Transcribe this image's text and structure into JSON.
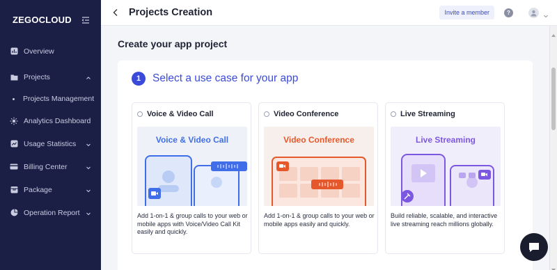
{
  "brand": {
    "logo": "ZEGOCLOUD"
  },
  "sidebar": {
    "items": [
      {
        "label": "Overview",
        "icon": "overview-icon"
      },
      {
        "label": "Projects",
        "icon": "projects-icon",
        "expanded": true
      },
      {
        "label": "Projects Management",
        "sub": true
      },
      {
        "label": "Analytics Dashboard",
        "icon": "analytics-icon"
      },
      {
        "label": "Usage Statistics",
        "icon": "usage-icon"
      },
      {
        "label": "Billing Center",
        "icon": "billing-icon"
      },
      {
        "label": "Package",
        "icon": "package-icon"
      },
      {
        "label": "Operation Report",
        "icon": "report-icon"
      }
    ]
  },
  "header": {
    "title": "Projects Creation",
    "invite_label": "Invite a member",
    "help_glyph": "?"
  },
  "main": {
    "heading": "Create your app project",
    "step": {
      "number": "1",
      "title": "Select a use case for your app"
    },
    "cards": [
      {
        "label": "Voice & Video Call",
        "art_title": "Voice & Video Call",
        "art_color": "#3f6ee8",
        "description": "Add 1-on-1 & group calls to your web or mobile apps with Voice/Video Call Kit easily and quickly."
      },
      {
        "label": "Video Conference",
        "art_title": "Video Conference",
        "art_color": "#e4582b",
        "description": "Add 1-on-1 & group calls to your web or mobile apps easily and quickly."
      },
      {
        "label": "Live Streaming",
        "art_title": "Live Streaming",
        "art_color": "#7c57e0",
        "description": "Build reliable, scalable, and interactive live streaming reach millions globally."
      }
    ]
  },
  "colors": {
    "sidebar_bg": "#1b1e45",
    "accent": "#3b4bd9"
  }
}
